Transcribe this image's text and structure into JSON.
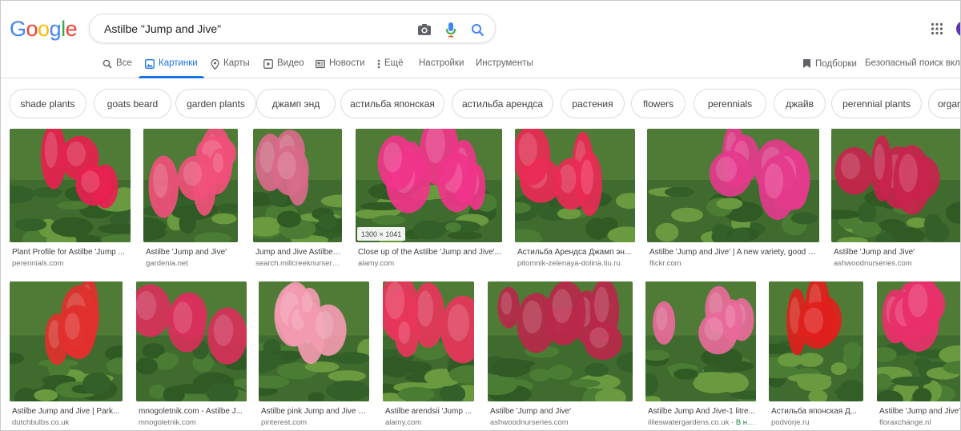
{
  "search": {
    "query": "Astilbe \"Jump and Jive\""
  },
  "logo": {
    "letters": [
      "G",
      "o",
      "o",
      "g",
      "l",
      "e"
    ],
    "colors": [
      "#4285f4",
      "#ea4335",
      "#fbbc05",
      "#4285f4",
      "#34a853",
      "#ea4335"
    ]
  },
  "tabs": [
    {
      "label": "Все",
      "icon": "search-icon",
      "active": false
    },
    {
      "label": "Картинки",
      "icon": "image-icon",
      "active": true
    },
    {
      "label": "Карты",
      "icon": "map-pin-icon",
      "active": false
    },
    {
      "label": "Видео",
      "icon": "video-icon",
      "active": false
    },
    {
      "label": "Новости",
      "icon": "news-icon",
      "active": false
    },
    {
      "label": "Ещё",
      "icon": "more-vert-icon",
      "active": false
    },
    {
      "label": "Настройки",
      "icon": "",
      "active": false
    },
    {
      "label": "Инструменты",
      "icon": "",
      "active": false
    }
  ],
  "right_links": {
    "collections": "Подборки",
    "safesearch": "Безопасный поиск вклю"
  },
  "chips": [
    "shade plants",
    "goats beard",
    "garden plants",
    "джамп энд",
    "астильба японская",
    "астильба арендса",
    "растения",
    "flowers",
    "perennials",
    "джайв",
    "perennial plants",
    "organic ga"
  ],
  "colors": {
    "accent": "#1a73e8",
    "text_secondary": "#5f6368",
    "green_badge": "#188038"
  },
  "results_row1": [
    {
      "title": "Plant Profile for Astilbe 'Jump ...",
      "source": "perennials.com",
      "flower": "#e8204f"
    },
    {
      "title": "Astilbe 'Jump and Jive'",
      "source": "gardenia.net",
      "flower": "#f0507a"
    },
    {
      "title": "Jump and Jive Astilbe ...",
      "source": "search.millcreeknursery.ca",
      "flower": "#d86a8a"
    },
    {
      "title": "Close up of the Astilbe 'Jump and Jive'...",
      "source": "alamy.com",
      "flower": "#f0348a",
      "dimensions": "1300 × 1041"
    },
    {
      "title": "Астильба Арендса Джамп эн...",
      "source": "pitomnik-zelenaya-dolina.tiu.ru",
      "flower": "#ea2a55"
    },
    {
      "title": "Astilbe 'Jump and Jive' | A new variety, good d...",
      "source": "flickr.com",
      "flower": "#e43a8c"
    },
    {
      "title": "Astilbe 'Jump and Jive'",
      "source": "ashwoodnurseries.com",
      "flower": "#c8234c"
    }
  ],
  "results_row2": [
    {
      "title": "Astilbe Jump and Jive | Park...",
      "source": "dutchbulbs.co.uk",
      "flower": "#e0302c"
    },
    {
      "title": "mnogoletnik.com - Astilbe J...",
      "source": "mnogoletnik.com",
      "flower": "#d8305a"
    },
    {
      "title": "Astilbe pink Jump and Jive - ...",
      "source": "pinterest.com",
      "flower": "#f39ab0"
    },
    {
      "title": "Astilbe arendsii 'Jump ...",
      "source": "alamy.com",
      "flower": "#e8355a"
    },
    {
      "title": "Astilbe 'Jump and Jive'",
      "source": "ashwoodnurseries.com",
      "flower": "#b8284a"
    },
    {
      "title": "Astilbe Jump And Jive-1 litre...",
      "source": "illieswatergardens.co.uk",
      "badge": "· В на...",
      "flower": "#e86a9a"
    },
    {
      "title": "Астильба японская Д...",
      "source": "podvorje.ru",
      "flower": "#e0201c"
    },
    {
      "title": "Astilbe 'Jump and Jive'",
      "source": "floraxchange.nl",
      "flower": "#e8306a"
    }
  ]
}
